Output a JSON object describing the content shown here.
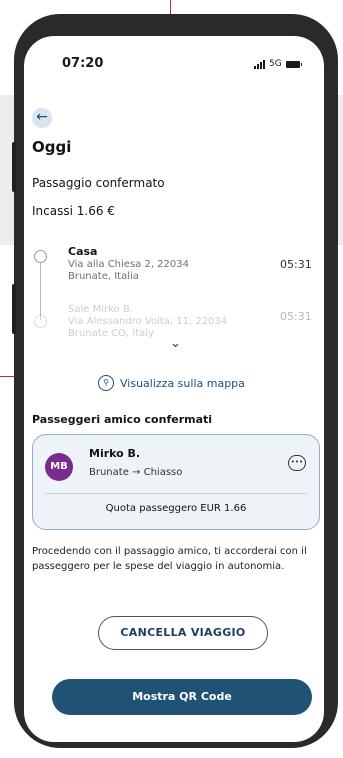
{
  "status_bar": {
    "time": "07:20",
    "network": "5G"
  },
  "page": {
    "title": "Oggi",
    "subtitle": "Passaggio confermato",
    "income": "Incassi 1.66 €"
  },
  "stops": [
    {
      "name": "Casa",
      "address": "Via alla Chiesa 2, 22034",
      "city": "Brunate, Italia",
      "time": "05:31"
    },
    {
      "name": "Sale Mirko B.",
      "address": "Via Alessandro Volta, 11, 22034",
      "city": "Brunate CO, Italy",
      "time": "05:31"
    }
  ],
  "map_link": "Visualizza sulla mappa",
  "passengers": {
    "title": "Passeggeri amico confermati",
    "items": [
      {
        "initials": "MB",
        "name": "Mirko B.",
        "from": "Brunate",
        "to": "Chiasso",
        "quota": "Quota passeggero EUR 1.66"
      }
    ]
  },
  "notice": "Procedendo con il passaggio amico, ti accorderai con il passeggero per le spese del viaggio in autonomia.",
  "buttons": {
    "cancel": "CANCELLA VIAGGIO",
    "qr": "Mostra QR Code"
  },
  "icons": [
    "back-arrow-icon",
    "map-icon",
    "chat-icon",
    "chevron-down-icon",
    "signal-icon",
    "battery-icon"
  ],
  "colors": {
    "primary": "#1f5275",
    "avatar": "#7a2b8f",
    "card_border": "#8fb0cc",
    "card_bg": "#eef3f8"
  }
}
